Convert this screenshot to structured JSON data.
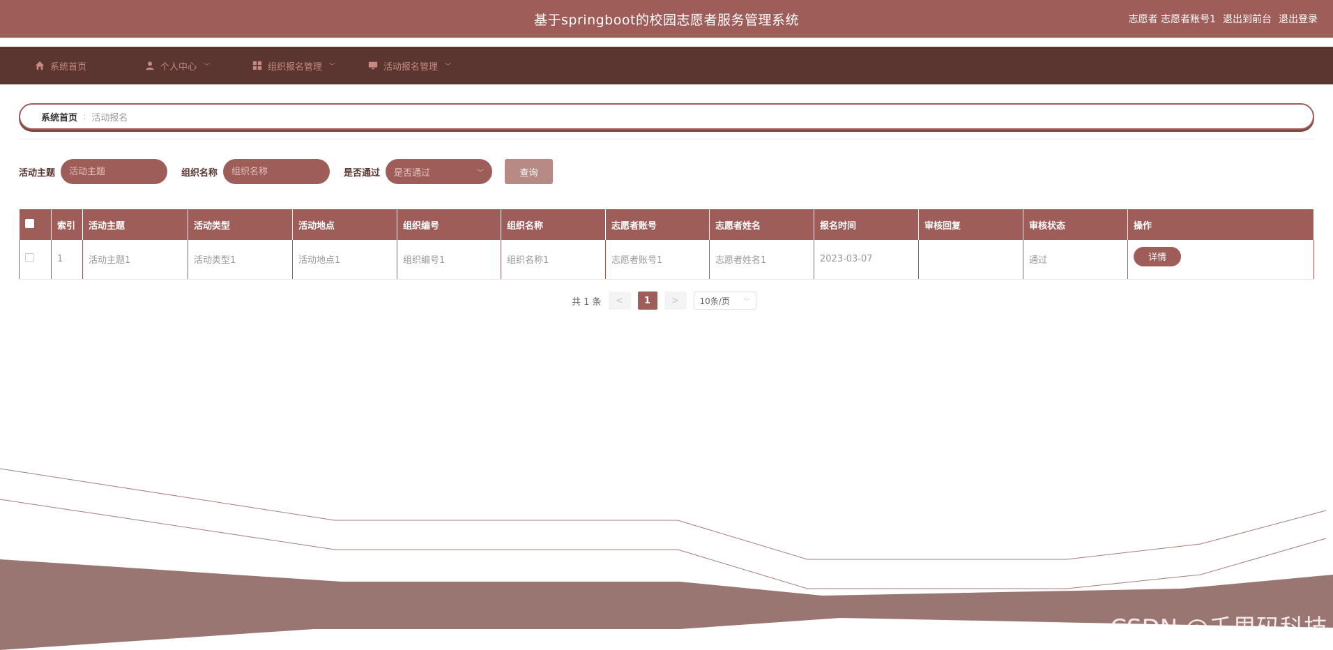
{
  "header": {
    "title": "基于springboot的校园志愿者服务管理系统",
    "user_label": "志愿者 志愿者账号1",
    "front_link": "退出到前台",
    "logout_link": "退出登录"
  },
  "nav": {
    "items": [
      {
        "label": "系统首页",
        "icon": "home-icon",
        "has_dropdown": false
      },
      {
        "label": "个人中心",
        "icon": "user-icon",
        "has_dropdown": true
      },
      {
        "label": "组织报名管理",
        "icon": "grid-icon",
        "has_dropdown": true
      },
      {
        "label": "活动报名管理",
        "icon": "monitor-icon",
        "has_dropdown": true
      }
    ]
  },
  "breadcrumb": {
    "home": "系统首页",
    "separator": ":",
    "current": "活动报名"
  },
  "search": {
    "theme_label": "活动主题",
    "theme_placeholder": "活动主题",
    "org_label": "组织名称",
    "org_placeholder": "组织名称",
    "pass_label": "是否通过",
    "pass_placeholder": "是否通过",
    "query_button": "查询"
  },
  "table": {
    "headers": [
      "索引",
      "活动主题",
      "活动类型",
      "活动地点",
      "组织编号",
      "组织名称",
      "志愿者账号",
      "志愿者姓名",
      "报名时间",
      "审核回复",
      "审核状态",
      "操作"
    ],
    "rows": [
      {
        "index": "1",
        "theme": "活动主题1",
        "type": "活动类型1",
        "location": "活动地点1",
        "org_no": "组织编号1",
        "org_name": "组织名称1",
        "volunteer_account": "志愿者账号1",
        "volunteer_name": "志愿者姓名1",
        "signup_time": "2023-03-07",
        "review_reply": "",
        "review_status": "通过",
        "action": "详情"
      }
    ]
  },
  "pagination": {
    "total": "共 1 条",
    "prev": "<",
    "current": "1",
    "next": ">",
    "page_size": "10条/页"
  },
  "watermark": "CSDN @千里码科技",
  "colors": {
    "header_bg": "#9e5d58",
    "nav_bg": "#5b3630",
    "nav_text": "#c9897f",
    "wave": "#9a7672"
  }
}
